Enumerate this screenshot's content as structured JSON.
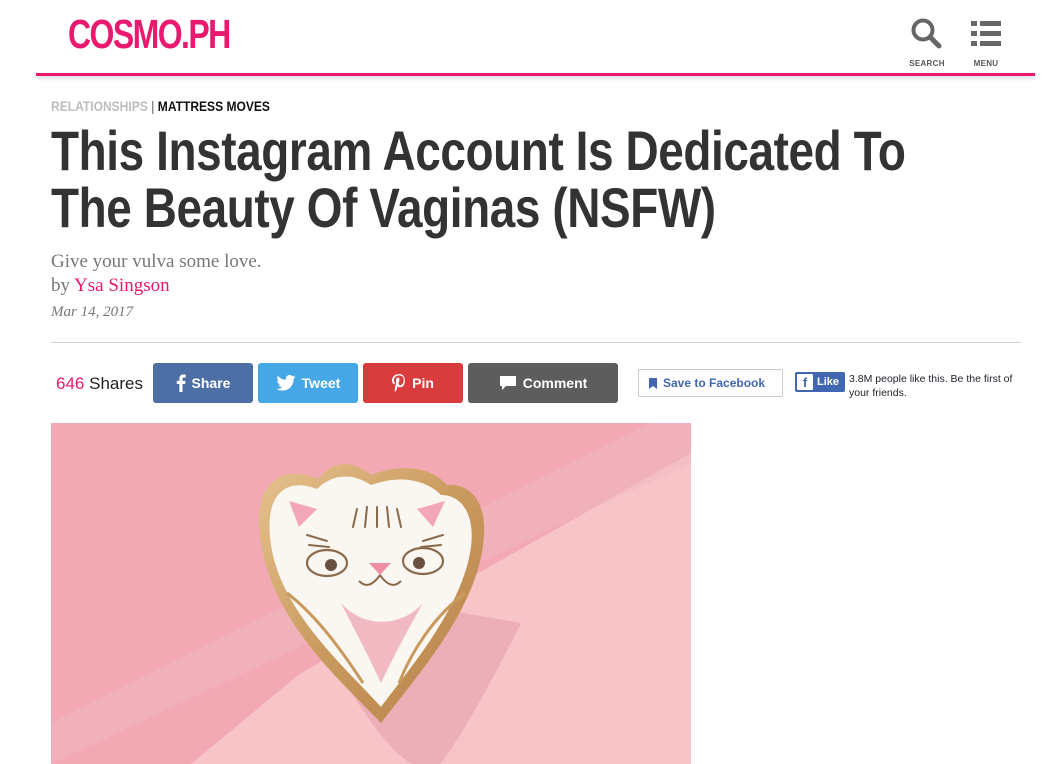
{
  "header": {
    "logo": "COSMO.PH",
    "search_label": "SEARCH",
    "menu_label": "MENU",
    "accent_color": "#e8196f"
  },
  "article": {
    "section": "RELATIONSHIPS",
    "separator": "|",
    "subsection": "MATTRESS MOVES",
    "title": "This Instagram Account Is Dedicated To The Beauty Of Vaginas (NSFW)",
    "dek": "Give your vulva some love.",
    "by_prefix": "by",
    "author": "Ysa Singson",
    "date": "Mar 14, 2017"
  },
  "share_bar": {
    "share_count": "646",
    "shares_label": "Shares",
    "buttons": [
      {
        "label": "Share",
        "icon": "facebook-icon",
        "color": "#4e6fa6"
      },
      {
        "label": "Tweet",
        "icon": "twitter-icon",
        "color": "#45a7e6"
      },
      {
        "label": "Pin",
        "icon": "pinterest-icon",
        "color": "#d93c3c"
      },
      {
        "label": "Comment",
        "icon": "comment-icon",
        "color": "#5d5d5d"
      }
    ],
    "save_to_facebook": "Save to Facebook",
    "like_label": "Like",
    "like_text": "3.8M people like this. Be the first of your friends."
  },
  "hero_image": {
    "subject": "heart-shaped enamel cat pin on pink paper"
  }
}
